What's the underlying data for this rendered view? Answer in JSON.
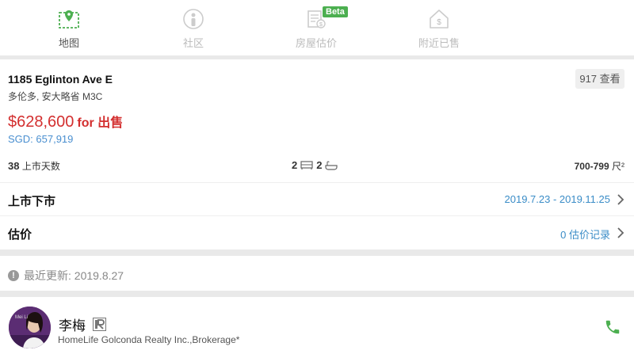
{
  "tabs": [
    {
      "label": "地图",
      "icon": "map-icon",
      "active": true
    },
    {
      "label": "社区",
      "icon": "community-icon",
      "active": false
    },
    {
      "label": "房屋估价",
      "icon": "valuation-icon",
      "active": false,
      "badge": "Beta"
    },
    {
      "label": "附近已售",
      "icon": "sold-nearby-icon",
      "active": false
    }
  ],
  "listing": {
    "address": "1185 Eglinton Ave E",
    "region": "多伦多, 安大略省 M3C",
    "views": "917 查看",
    "price": "$628,600",
    "for_sale": "for 出售",
    "sgd": "SGD: 657,919",
    "days_on_market": "38",
    "days_label": "上市天数",
    "bedrooms": "2",
    "bathrooms": "2",
    "size": "700-799",
    "size_unit": "尺²"
  },
  "rows": {
    "listing_period": {
      "title": "上市下市",
      "value": "2019.7.23 - 2019.11.25"
    },
    "estimate": {
      "title": "估价",
      "value": "0 估价记录"
    }
  },
  "update": {
    "text": "最近更新: 2019.8.27"
  },
  "agent": {
    "name": "李梅",
    "agency": "HomeLife Golconda Realty Inc.,Brokerage*"
  },
  "colors": {
    "accent": "#4caf50",
    "price": "#d32f2f",
    "link": "#3a8cc7"
  }
}
